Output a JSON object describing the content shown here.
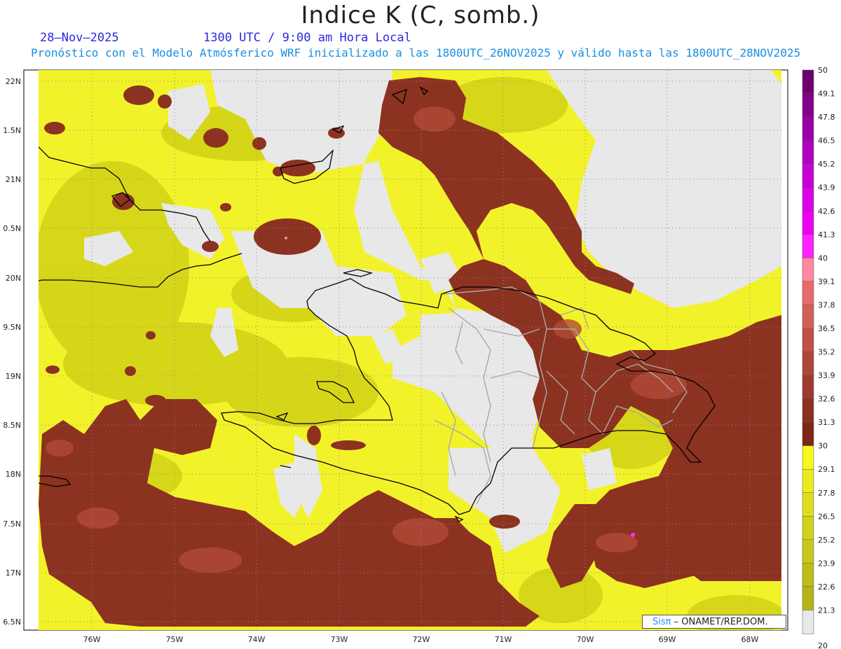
{
  "title": "Indice K (C, somb.)",
  "date": "28–Nov–2025",
  "time": "1300 UTC / 9:00 am Hora Local",
  "forecast_text": "Pronóstico con el Modelo Atmósferico WRF inicializado a las 1800UTC_26NOV2025 y válido hasta las  1800UTC_28NOV2025",
  "credit": {
    "logo": "Sisπ",
    "text": "– ONAMET/REP.DOM."
  },
  "axes": {
    "x_ticks": [
      "76W",
      "75W",
      "74W",
      "73W",
      "72W",
      "71W",
      "70W",
      "69W",
      "68W"
    ],
    "y_ticks": [
      "22N",
      "1.5N",
      "21N",
      "0.5N",
      "20N",
      "9.5N",
      "19N",
      "8.5N",
      "18N",
      "7.5N",
      "17N",
      "6.5N"
    ]
  },
  "colorbar": {
    "labels": [
      "50",
      "49.1",
      "47.8",
      "46.5",
      "45.2",
      "43.9",
      "42.6",
      "41.3",
      "40",
      "39.1",
      "37.8",
      "36.5",
      "35.2",
      "33.9",
      "32.6",
      "31.3",
      "30",
      "29.1",
      "27.8",
      "26.5",
      "25.2",
      "23.9",
      "22.6",
      "21.3",
      "20"
    ],
    "colors": [
      "#6e006e",
      "#82008a",
      "#9a00a8",
      "#b000c0",
      "#c800d8",
      "#dc00e8",
      "#ee00f4",
      "#ff20ff",
      "#ff88a0",
      "#e86a6a",
      "#d45e58",
      "#c25048",
      "#b0453c",
      "#9e3a30",
      "#8c3022",
      "#7a2814",
      "#f8f820",
      "#eaea1e",
      "#dede1e",
      "#d2d21c",
      "#c8c81a",
      "#bdbd18",
      "#b4b416",
      "#e8e8e8"
    ]
  },
  "colors": {
    "no_data": "#e8e8e8",
    "low": "#f7f722",
    "mid": "#c8c80e",
    "high": "#8a3020",
    "coast": "#000000",
    "provinces": "#a0a0a0"
  }
}
